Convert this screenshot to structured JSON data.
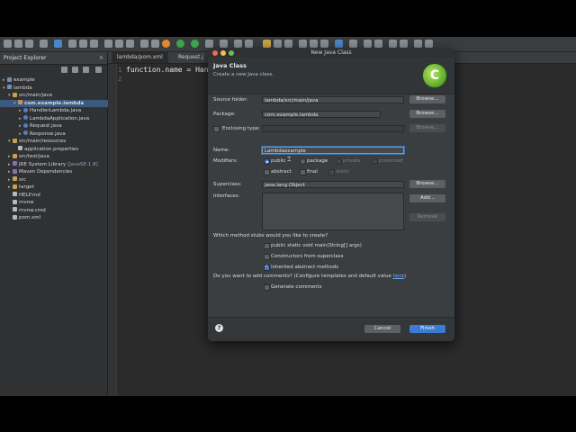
{
  "explorer": {
    "title": "Project Explorer",
    "close": "✕",
    "tree": [
      {
        "label": "example",
        "icon": "proj",
        "indent": 0,
        "twisty": "▸"
      },
      {
        "label": "lambda",
        "icon": "proj",
        "indent": 0,
        "twisty": "▾"
      },
      {
        "label": "src/main/java",
        "icon": "src",
        "indent": 1,
        "twisty": "▾"
      },
      {
        "label": "com.example.lambda",
        "icon": "pkg",
        "indent": 2,
        "twisty": "▾",
        "selected": true,
        "bold": true
      },
      {
        "label": "HandlerLambda.java",
        "icon": "java",
        "indent": 3,
        "twisty": "▸"
      },
      {
        "label": "LambdaApplication.java",
        "icon": "java",
        "indent": 3,
        "twisty": "▸"
      },
      {
        "label": "Request.java",
        "icon": "java",
        "indent": 3,
        "twisty": "▸"
      },
      {
        "label": "Response.java",
        "icon": "java",
        "indent": 3,
        "twisty": "▸"
      },
      {
        "label": "src/main/resources",
        "icon": "src",
        "indent": 1,
        "twisty": "▾"
      },
      {
        "label": "application.properties",
        "icon": "file",
        "indent": 2,
        "twisty": ""
      },
      {
        "label": "src/test/java",
        "icon": "src",
        "indent": 1,
        "twisty": "▸"
      },
      {
        "label": "JRE System Library",
        "suffix": "[JavaSE-1.8]",
        "icon": "lib",
        "indent": 1,
        "twisty": "▸"
      },
      {
        "label": "Maven Dependencies",
        "icon": "lib",
        "indent": 1,
        "twisty": "▸"
      },
      {
        "label": "src",
        "icon": "src",
        "indent": 1,
        "twisty": "▸"
      },
      {
        "label": "target",
        "icon": "src",
        "indent": 1,
        "twisty": "▸"
      },
      {
        "label": "HELP.md",
        "icon": "file",
        "indent": 1,
        "twisty": ""
      },
      {
        "label": "mvnw",
        "icon": "file",
        "indent": 1,
        "twisty": ""
      },
      {
        "label": "mvnw.cmd",
        "icon": "file",
        "indent": 1,
        "twisty": ""
      },
      {
        "label": "pom.xml",
        "icon": "file",
        "indent": 1,
        "twisty": ""
      }
    ]
  },
  "editor": {
    "tabs": [
      "lambda/pom.xml",
      "Request.j"
    ],
    "lines": [
      {
        "no": "1",
        "code": "function.name = Handl"
      },
      {
        "no": "2",
        "code": ""
      }
    ]
  },
  "dialog": {
    "window_title": "New Java Class",
    "heading": "Java Class",
    "subheading": "Create a new Java class.",
    "logo_letter": "C",
    "source_folder": {
      "label": "Source folder:",
      "value": "lambda/src/main/java",
      "button": "Browse..."
    },
    "package": {
      "label": "Package:",
      "value": "com.example.lambda",
      "button": "Browse..."
    },
    "enclosing": {
      "label": "Enclosing type:",
      "value": "",
      "button": "Browse..."
    },
    "name": {
      "label": "Name:",
      "value": "Lambdaexample"
    },
    "modifiers": {
      "label": "Modifiers:",
      "radios": [
        {
          "label": "public",
          "checked": true,
          "disabled": false
        },
        {
          "label": "package",
          "checked": false,
          "disabled": false
        },
        {
          "label": "private",
          "checked": false,
          "disabled": true
        },
        {
          "label": "protected",
          "checked": false,
          "disabled": true
        }
      ],
      "checks": [
        {
          "label": "abstract",
          "checked": false,
          "disabled": false
        },
        {
          "label": "final",
          "checked": false,
          "disabled": false
        },
        {
          "label": "static",
          "checked": false,
          "disabled": true
        }
      ]
    },
    "superclass": {
      "label": "Superclass:",
      "value": "java.lang.Object",
      "button": "Browse..."
    },
    "interfaces": {
      "label": "Interfaces:",
      "add": "Add...",
      "remove": "Remove"
    },
    "stubs": {
      "question": "Which method stubs would you like to create?",
      "options": [
        {
          "label": "public static void main(String[] args)",
          "checked": false
        },
        {
          "label": "Constructors from superclass",
          "checked": false
        },
        {
          "label": "Inherited abstract methods",
          "checked": true
        }
      ]
    },
    "comments": {
      "question": "Do you want to add comments? (Configure templates and default value ",
      "link": "here",
      "question_end": ")",
      "option": "Generate comments"
    },
    "help": "?",
    "cancel": "Cancel",
    "finish": "Finish"
  }
}
